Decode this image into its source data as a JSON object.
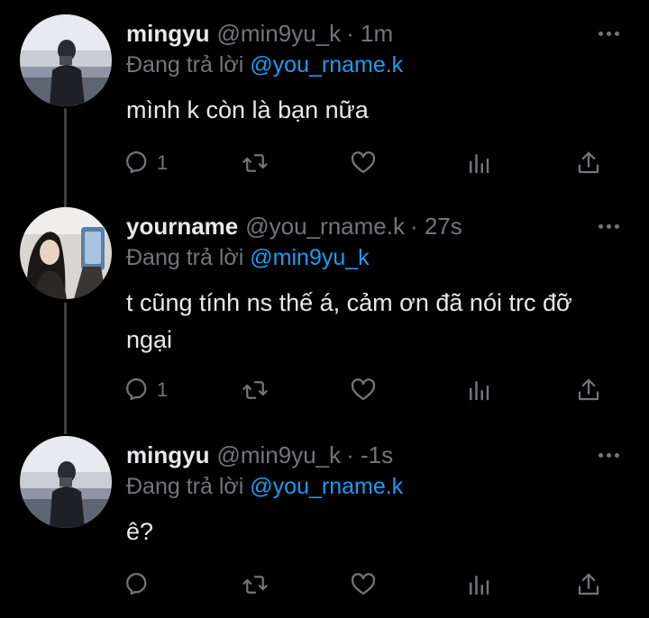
{
  "tweets": [
    {
      "name": "mingyu",
      "handle": "@min9yu_k",
      "time": "· 1m",
      "reply_prefix": "Đang trả lời ",
      "reply_to": "@you_rname.k",
      "text": "mình k còn là bạn nữa",
      "reply_count": "1",
      "avatar": "man-mirror-selfie"
    },
    {
      "name": "yourname",
      "handle": "@you_rname.k",
      "time": "· 27s",
      "reply_prefix": "Đang trả lời ",
      "reply_to": "@min9yu_k",
      "text": "t cũng tính ns thế á, cảm ơn đã nói trc đỡ ngại",
      "reply_count": "1",
      "avatar": "woman-phone-selfie"
    },
    {
      "name": "mingyu",
      "handle": "@min9yu_k",
      "time": "· -1s",
      "reply_prefix": "Đang trả lời ",
      "reply_to": "@you_rname.k",
      "text": "ê?",
      "reply_count": "",
      "avatar": "man-mirror-selfie"
    }
  ],
  "icons": {
    "reply": "reply-icon",
    "retweet": "retweet-icon",
    "like": "like-icon",
    "views": "views-icon",
    "share": "share-icon",
    "more": "more-icon"
  },
  "colors": {
    "background": "#000000",
    "text": "#e7e9ea",
    "secondary": "#71767b",
    "mention": "#1d9bf0",
    "thread_line": "#3e4144"
  }
}
